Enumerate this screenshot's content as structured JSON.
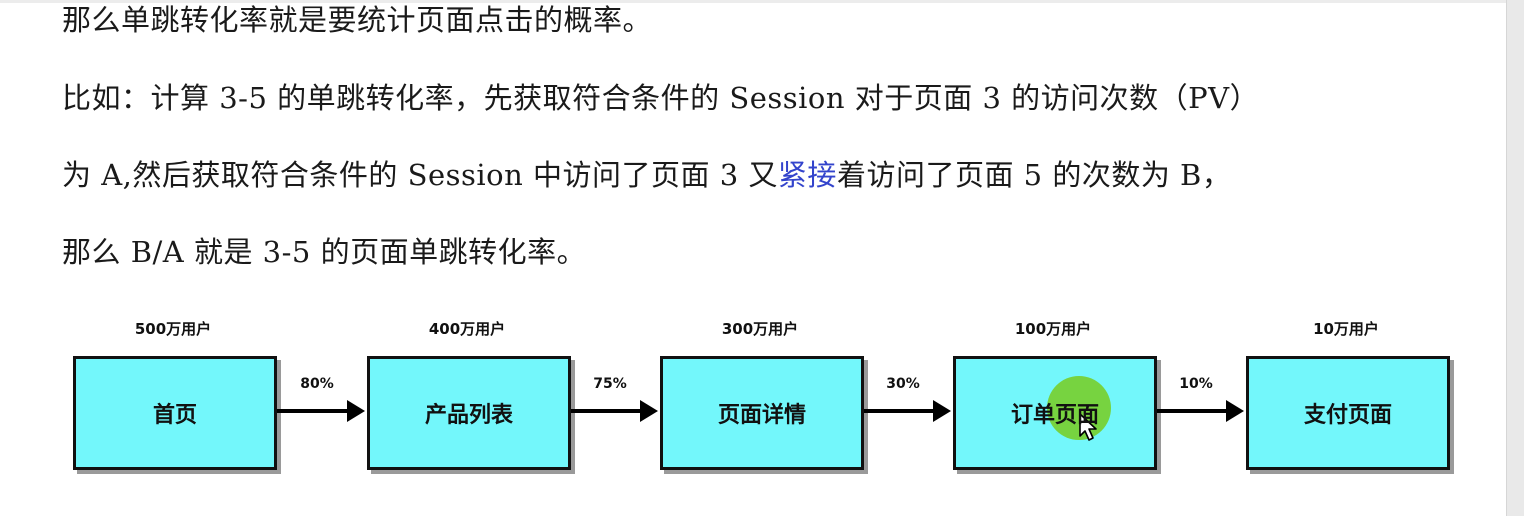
{
  "paragraphs": {
    "line1": "那么单跳转化率就是要统计页面点击的概率。",
    "line2": "比如：计算  3-5  的单跳转化率，先获取符合条件的  Session  对于页面  3  的访问次数（PV）",
    "line3_pre": "为  A,然后获取符合条件的  Session  中访问了页面  3  又",
    "line3_link": "紧接",
    "line3_post": "着访问了页面  5  的次数为  B，",
    "line4": "那么  B/A  就是  3-5  的页面单跳转化率。"
  },
  "funnel": {
    "steps": [
      {
        "label": "首页",
        "users": "500万用户"
      },
      {
        "label": "产品列表",
        "users": "400万用户"
      },
      {
        "label": "页面详情",
        "users": "300万用户"
      },
      {
        "label": "订单页面",
        "users": "100万用户"
      },
      {
        "label": "支付页面",
        "users": "10万用户"
      }
    ],
    "rates": [
      "80%",
      "75%",
      "30%",
      "10%"
    ],
    "colors": {
      "box_fill": "#73f7fb",
      "highlight": "#78cd1e",
      "link": "#3344cc"
    }
  }
}
